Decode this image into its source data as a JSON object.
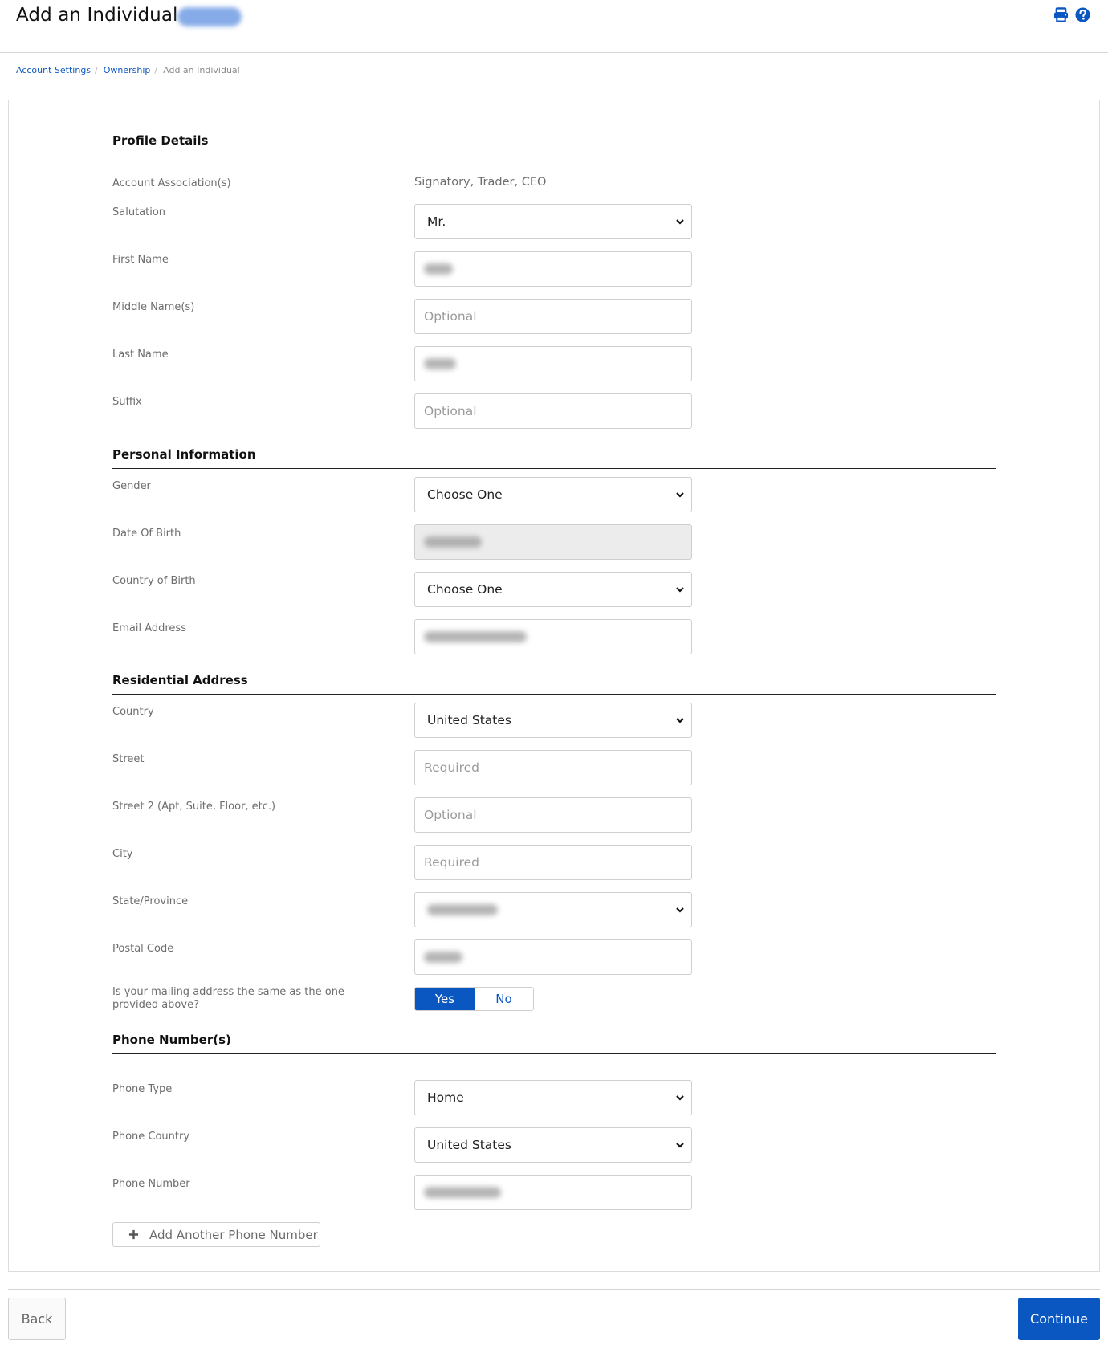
{
  "header": {
    "title": "Add an Individual",
    "icons": [
      "print-icon",
      "help-icon"
    ]
  },
  "breadcrumb": [
    {
      "label": "Account Settings"
    },
    {
      "label": "Ownership"
    },
    {
      "label": "Add an Individual"
    }
  ],
  "sections": {
    "profile": "Profile Details",
    "personal": "Personal Information",
    "residential": "Residential Address",
    "phone": "Phone Number(s)"
  },
  "profile": {
    "account_associations": {
      "label": "Account Association(s)",
      "value": "Signatory, Trader, CEO"
    },
    "salutation": {
      "label": "Salutation",
      "value": "Mr."
    },
    "first_name": {
      "label": "First Name",
      "value": "[redacted]"
    },
    "middle_name": {
      "label": "Middle Name(s)",
      "placeholder": "Optional"
    },
    "last_name": {
      "label": "Last Name",
      "value": "[redacted]"
    },
    "suffix": {
      "label": "Suffix",
      "placeholder": "Optional"
    }
  },
  "personal": {
    "gender": {
      "label": "Gender",
      "value": "Choose One"
    },
    "dob": {
      "label": "Date Of Birth",
      "value": "[redacted]"
    },
    "country_of_birth": {
      "label": "Country of Birth",
      "value": "Choose One"
    },
    "email": {
      "label": "Email Address",
      "value": "[redacted]"
    }
  },
  "residential": {
    "country": {
      "label": "Country",
      "value": "United States"
    },
    "street": {
      "label": "Street",
      "placeholder": "Required"
    },
    "street2": {
      "label": "Street 2 (Apt, Suite, Floor, etc.)",
      "placeholder": "Optional"
    },
    "city": {
      "label": "City",
      "placeholder": "Required"
    },
    "state": {
      "label": "State/Province",
      "value": "[redacted]"
    },
    "postal": {
      "label": "Postal Code",
      "value": "[redacted]"
    },
    "mailing_same": {
      "label": "Is your mailing address the same as the one provided above?",
      "options": [
        "Yes",
        "No"
      ],
      "selected": "Yes"
    }
  },
  "phone": {
    "type": {
      "label": "Phone Type",
      "value": "Home"
    },
    "country": {
      "label": "Phone Country",
      "value": "United States"
    },
    "number": {
      "label": "Phone Number",
      "value": "[redacted]"
    },
    "add_label": "Add Another Phone Number"
  },
  "footer": {
    "back_label": "Back",
    "continue_label": "Continue"
  },
  "colors": {
    "accent": "#0b57c2",
    "label": "#6d6d6d",
    "border": "#cfcfcf",
    "disabled_bg": "#ececec"
  }
}
